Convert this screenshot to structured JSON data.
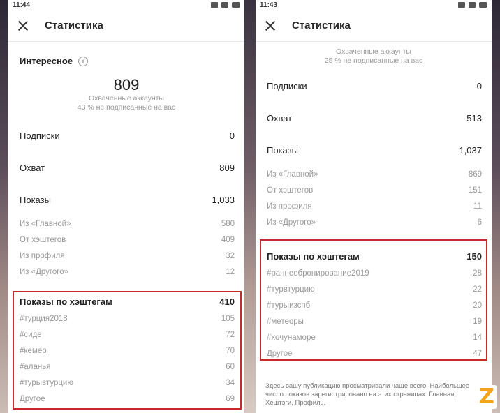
{
  "left": {
    "status_time": "11:44",
    "title": "Статистика",
    "section_title": "Интересное",
    "reach_value": "809",
    "reach_label": "Охваченные аккаунты",
    "reach_sub": "43 % не подписанные на вас",
    "rows": [
      {
        "label": "Подписки",
        "value": "0"
      },
      {
        "label": "Охват",
        "value": "809"
      },
      {
        "label": "Показы",
        "value": "1,033"
      }
    ],
    "impressions_breakdown": [
      {
        "label": "Из «Главной»",
        "value": "580"
      },
      {
        "label": "От хэштегов",
        "value": "409"
      },
      {
        "label": "Из профиля",
        "value": "32"
      },
      {
        "label": "Из «Другого»",
        "value": "12"
      }
    ],
    "hashtags_title": "Показы по хэштегам",
    "hashtags_total": "410",
    "hashtags": [
      {
        "label": "#турция2018",
        "value": "105"
      },
      {
        "label": "#сиде",
        "value": "72"
      },
      {
        "label": "#кемер",
        "value": "70"
      },
      {
        "label": "#аланья",
        "value": "60"
      },
      {
        "label": "#турывтурцию",
        "value": "34"
      },
      {
        "label": "Другое",
        "value": "69"
      }
    ]
  },
  "right": {
    "status_time": "11:43",
    "title": "Статистика",
    "reach_label": "Охваченные аккаунты",
    "reach_sub": "25 % не подписанные на вас",
    "rows": [
      {
        "label": "Подписки",
        "value": "0"
      },
      {
        "label": "Охват",
        "value": "513"
      },
      {
        "label": "Показы",
        "value": "1,037"
      }
    ],
    "impressions_breakdown": [
      {
        "label": "Из «Главной»",
        "value": "869"
      },
      {
        "label": "От хэштегов",
        "value": "151"
      },
      {
        "label": "Из профиля",
        "value": "11"
      },
      {
        "label": "Из «Другого»",
        "value": "6"
      }
    ],
    "hashtags_title": "Показы по хэштегам",
    "hashtags_total": "150",
    "hashtags": [
      {
        "label": "#раннеебронирование2019",
        "value": "28"
      },
      {
        "label": "#турвтурцию",
        "value": "22"
      },
      {
        "label": "#турыизспб",
        "value": "20"
      },
      {
        "label": "#метеоры",
        "value": "19"
      },
      {
        "label": "#хочунаморе",
        "value": "14"
      },
      {
        "label": "Другое",
        "value": "47"
      }
    ],
    "note": "Здесь вашу публикацию просматривали чаще всего. Наибольшее число показов зарегистрировано на этих страницах: Главная, Хештэги, Профиль."
  },
  "watermark": "Z",
  "accent_red": "#c7292f"
}
